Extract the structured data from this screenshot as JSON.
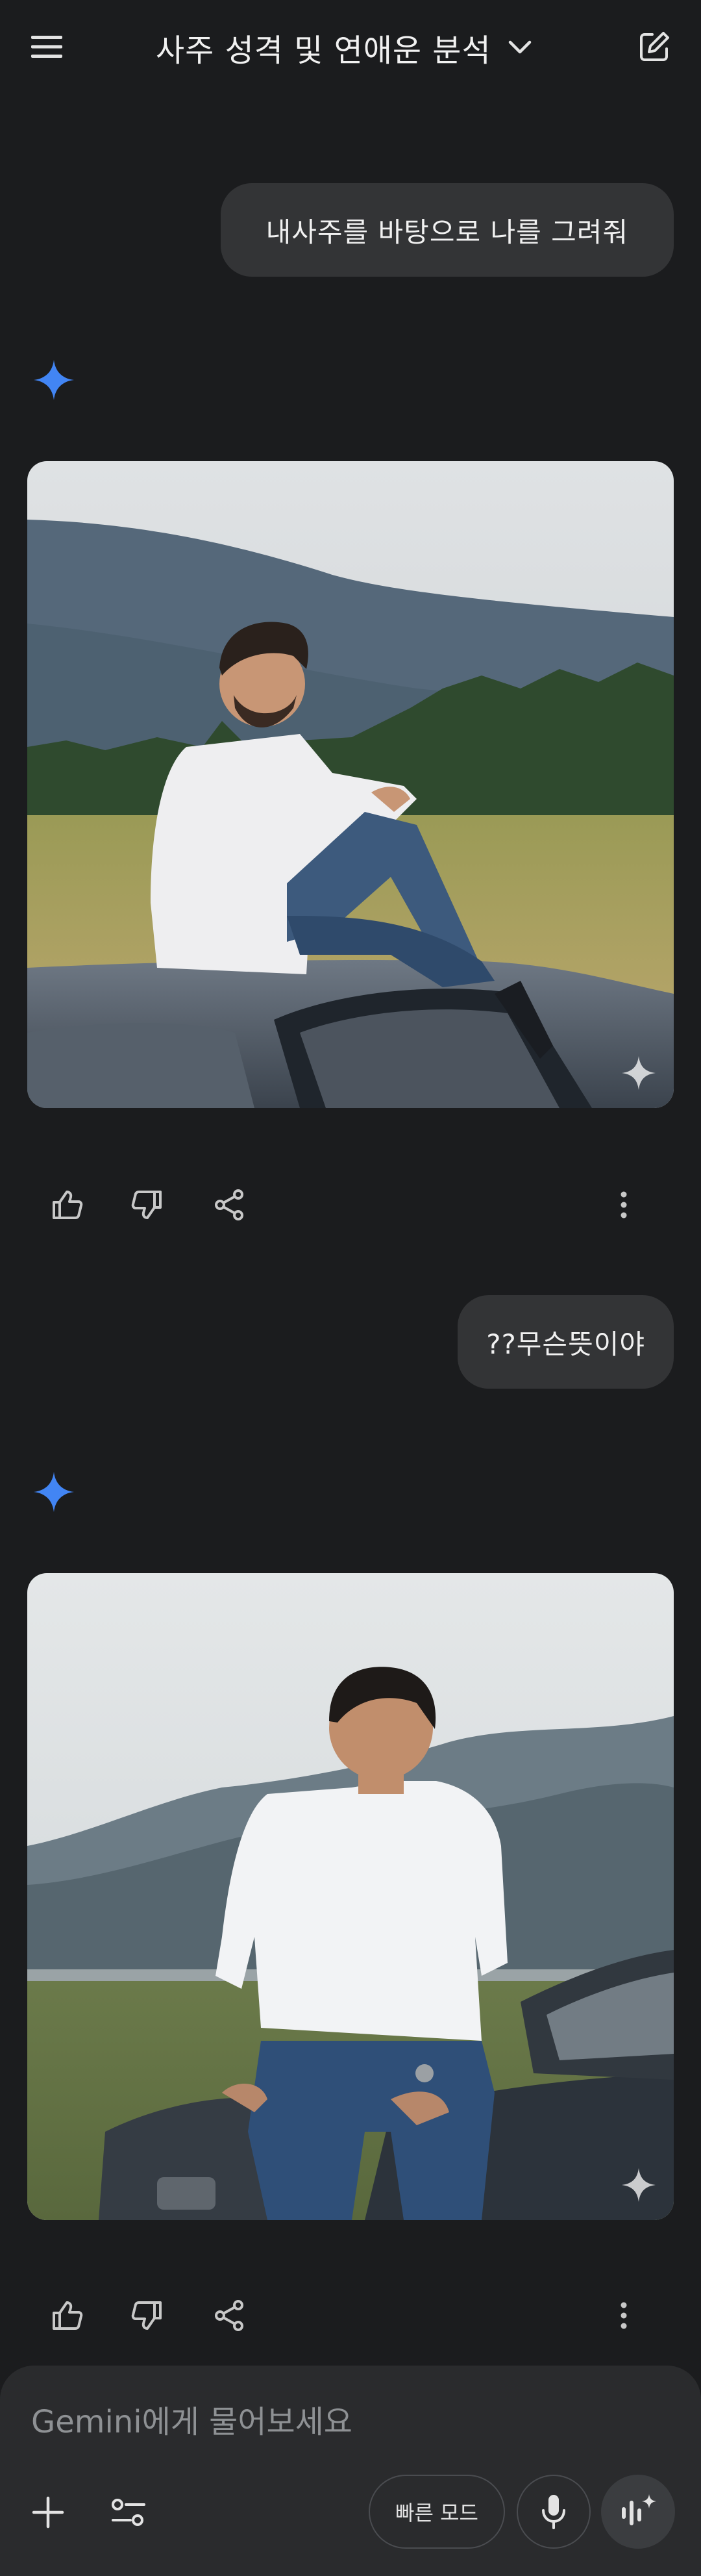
{
  "header": {
    "title": "사주 성격 및 연애운 분석"
  },
  "conversation": {
    "messages": [
      {
        "role": "user",
        "text": "내사주를 바탕으로 나를 그려줘"
      },
      {
        "role": "model",
        "content": "generated-image"
      },
      {
        "role": "user",
        "text": "??무슨뜻이야"
      },
      {
        "role": "model",
        "content": "generated-image"
      }
    ]
  },
  "composer": {
    "placeholder": "Gemini에게 물어보세요",
    "mode_label": "빠른 모드"
  },
  "colors": {
    "background": "#1b1c1e",
    "bubble": "#333436",
    "composer": "#2a2b2d",
    "gemini_spark": "#4285f4"
  }
}
